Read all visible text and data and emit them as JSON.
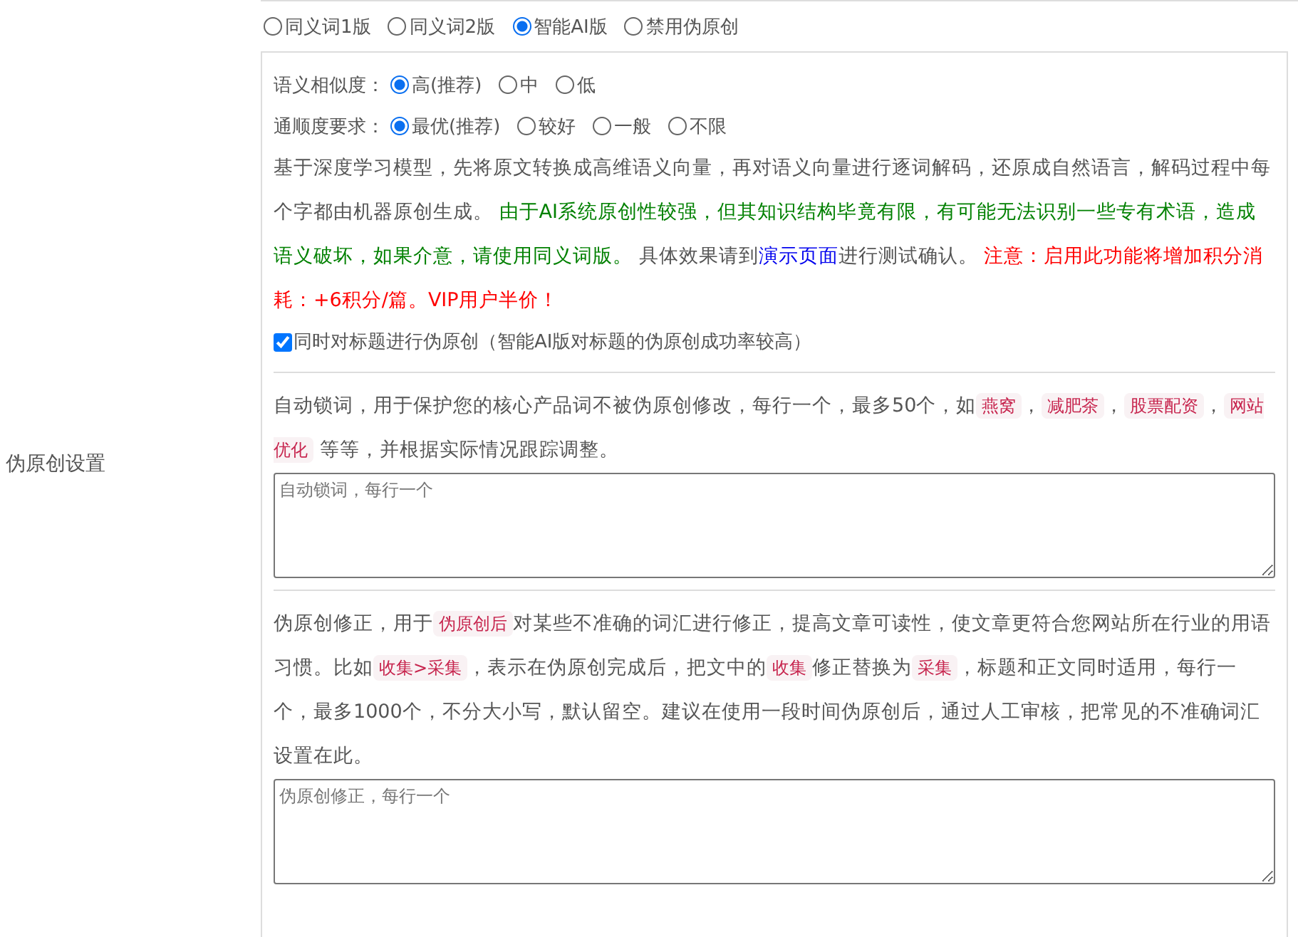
{
  "settings_label": "伪原创设置",
  "version_options": [
    {
      "label": "同义词1版",
      "selected": false
    },
    {
      "label": "同义词2版",
      "selected": false
    },
    {
      "label": "智能AI版",
      "selected": true
    },
    {
      "label": "禁用伪原创",
      "selected": false
    }
  ],
  "ai_settings": {
    "similarity": {
      "label": "语义相似度：",
      "options": [
        {
          "label": "高(推荐)",
          "selected": true
        },
        {
          "label": "中",
          "selected": false
        },
        {
          "label": "低",
          "selected": false
        }
      ]
    },
    "fluency": {
      "label": "通顺度要求：",
      "options": [
        {
          "label": "最优(推荐)",
          "selected": true
        },
        {
          "label": "较好",
          "selected": false
        },
        {
          "label": "一般",
          "selected": false
        },
        {
          "label": "不限",
          "selected": false
        }
      ]
    },
    "description": [
      {
        "kind": "text",
        "text": "基于深度学习模型，先将原文转换成高维语义向量，再对语义向量进行逐词解码，还原成自然语言，解码过程中每个字都由机器原创生成。 "
      },
      {
        "kind": "note",
        "text": "由于AI系统原创性较强，但其知识结构毕竟有限，有可能无法识别一些专有术语，造成语义破坏，如果介意，请使用同义词版。"
      },
      {
        "kind": "text",
        "text": " 具体效果请到"
      },
      {
        "kind": "link",
        "text": "演示页面"
      },
      {
        "kind": "text",
        "text": "进行测试确认。 "
      },
      {
        "kind": "warning",
        "text": "注意：启用此功能将增加积分消耗：+6积分/篇。VIP用户半价！"
      }
    ],
    "title_option": {
      "label": "同时对标题进行伪原创（智能AI版对标题的伪原创成功率较高）",
      "checked": true
    }
  },
  "lock_words": {
    "description": [
      {
        "kind": "text",
        "text": "自动锁词，用于保护您的核心产品词不被伪原创修改，每行一个，最多50个，如"
      },
      {
        "kind": "code",
        "text": "燕窝"
      },
      {
        "kind": "text",
        "text": "，"
      },
      {
        "kind": "code",
        "text": "减肥茶"
      },
      {
        "kind": "text",
        "text": "，"
      },
      {
        "kind": "code",
        "text": "股票配资"
      },
      {
        "kind": "text",
        "text": "，"
      },
      {
        "kind": "code",
        "text": "网站优化"
      },
      {
        "kind": "text",
        "text": " 等等，并根据实际情况跟踪调整。"
      }
    ],
    "placeholder": "自动锁词，每行一个"
  },
  "correction": {
    "description": [
      {
        "kind": "text",
        "text": "伪原创修正，用于"
      },
      {
        "kind": "code",
        "text": "伪原创后"
      },
      {
        "kind": "text",
        "text": "对某些不准确的词汇进行修正，提高文章可读性，使文章更符合您网站所在行业的用语习惯。比如"
      },
      {
        "kind": "code",
        "text": "收集>采集"
      },
      {
        "kind": "text",
        "text": "，表示在伪原创完成后，把文中的"
      },
      {
        "kind": "code",
        "text": "收集"
      },
      {
        "kind": "text",
        "text": "修正替换为"
      },
      {
        "kind": "code",
        "text": "采集"
      },
      {
        "kind": "text",
        "text": "，标题和正文同时适用，每行一个，最多1000个，不分大小写，默认留空。建议在使用一段时间伪原创后，通过人工审核，把常见的不准确词汇设置在此。"
      }
    ],
    "placeholder": "伪原创修正，每行一个"
  }
}
